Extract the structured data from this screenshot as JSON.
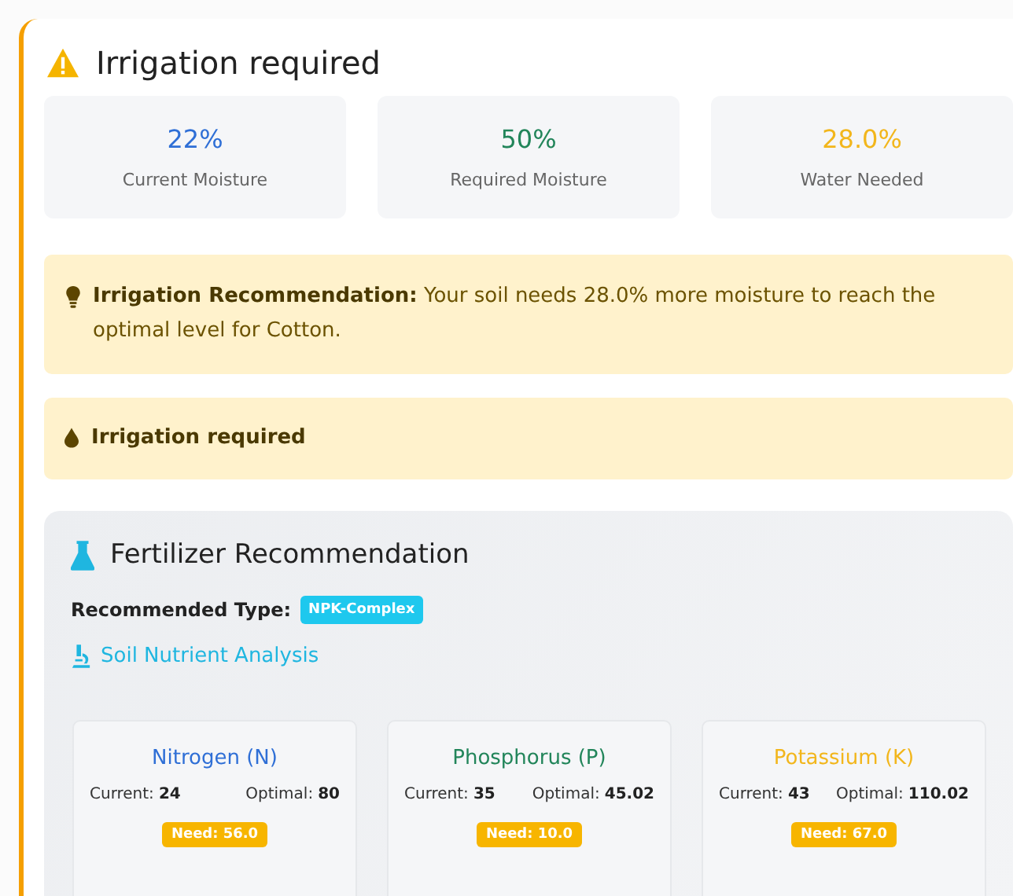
{
  "title": "Irrigation required",
  "stats": [
    {
      "value": "22%",
      "label": "Current Moisture",
      "color": "#2f6fd6"
    },
    {
      "value": "50%",
      "label": "Required Moisture",
      "color": "#22855a"
    },
    {
      "value": "28.0%",
      "label": "Water Needed",
      "color": "#f2b61c"
    }
  ],
  "alerts": [
    {
      "kind": "recommendation",
      "text": "**Irrigation Recommendation:** Your soil needs 28.0% more moisture to reach the optimal level for Cotton."
    },
    {
      "kind": "status",
      "text": "Irrigation required"
    }
  ],
  "fertilizer": {
    "heading": "Fertilizer Recommendation",
    "type_label": "Recommended Type:",
    "type_badge": "NPK-Complex",
    "analysis_link": "Soil Nutrient Analysis",
    "nutrients": [
      {
        "name": "Nitrogen (N)",
        "color": "#2f6fd6",
        "current_label": "Current:",
        "current": "24",
        "optimal_label": "Optimal:",
        "optimal": "80",
        "need": "Need: 56.0"
      },
      {
        "name": "Phosphorus (P)",
        "color": "#22855a",
        "current_label": "Current:",
        "current": "35",
        "optimal_label": "Optimal:",
        "optimal": "45.02",
        "need": "Need: 10.0"
      },
      {
        "name": "Potassium (K)",
        "color": "#f2b61c",
        "current_label": "Current:",
        "current": "43",
        "optimal_label": "Optimal:",
        "optimal": "110.02",
        "need": "Need: 67.0"
      }
    ]
  }
}
